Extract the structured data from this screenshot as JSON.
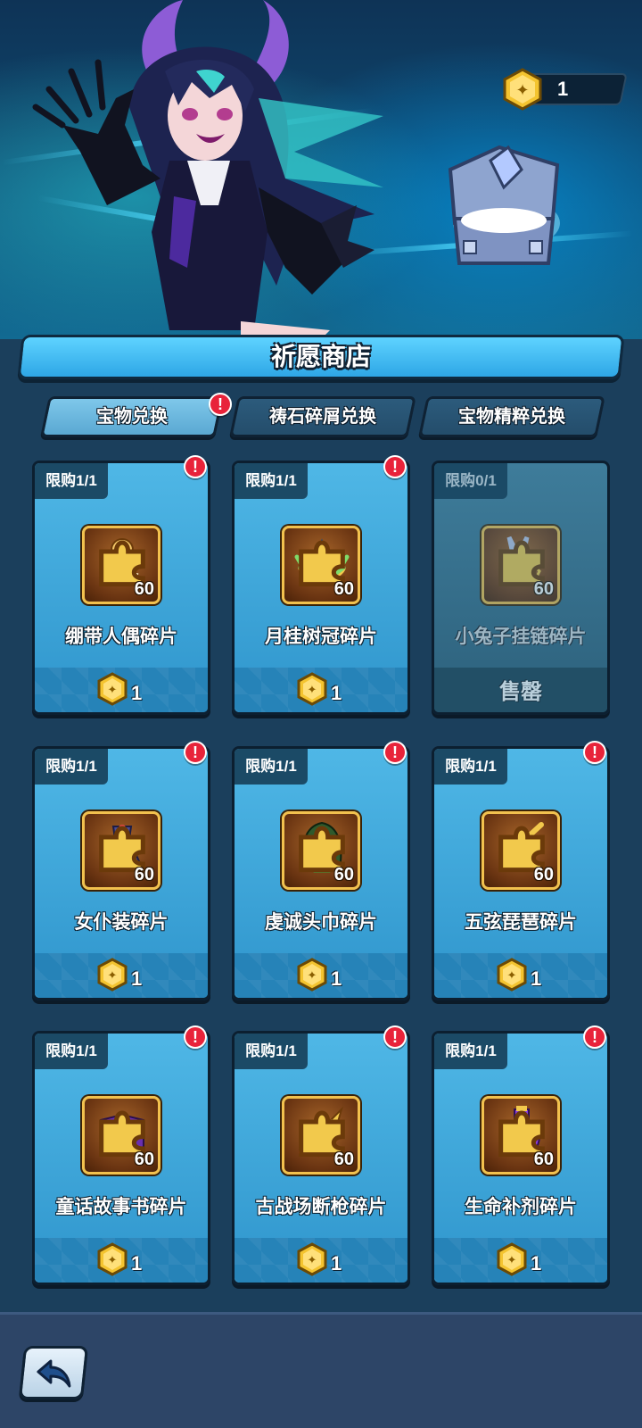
{
  "currency": {
    "icon": "gold-coin-icon",
    "amount": "1"
  },
  "shop": {
    "title": "祈愿商店"
  },
  "tabs": [
    {
      "label": "宝物兑换",
      "active": true,
      "alert": true
    },
    {
      "label": "祷石碎屑兑换",
      "active": false,
      "alert": false
    },
    {
      "label": "宝物精粹兑换",
      "active": false,
      "alert": false
    }
  ],
  "items": [
    {
      "limit": "限购1/1",
      "name": "绷带人偶碎片",
      "qty": "60",
      "price": "1",
      "sold_out": false,
      "alert": true,
      "icon": "bandage-doll-icon"
    },
    {
      "limit": "限购1/1",
      "name": "月桂树冠碎片",
      "qty": "60",
      "price": "1",
      "sold_out": false,
      "alert": true,
      "icon": "laurel-crown-icon"
    },
    {
      "limit": "限购0/1",
      "name": "小兔子挂链碎片",
      "qty": "60",
      "price": "",
      "sold_out": true,
      "sold_out_label": "售罄",
      "alert": false,
      "icon": "bunny-chain-icon"
    },
    {
      "limit": "限购1/1",
      "name": "女仆装碎片",
      "qty": "60",
      "price": "1",
      "sold_out": false,
      "alert": true,
      "icon": "maid-dress-icon"
    },
    {
      "limit": "限购1/1",
      "name": "虔诚头巾碎片",
      "qty": "60",
      "price": "1",
      "sold_out": false,
      "alert": true,
      "icon": "devout-hood-icon"
    },
    {
      "limit": "限购1/1",
      "name": "五弦琵琶碎片",
      "qty": "60",
      "price": "1",
      "sold_out": false,
      "alert": true,
      "icon": "pipa-lute-icon"
    },
    {
      "limit": "限购1/1",
      "name": "童话故事书碎片",
      "qty": "60",
      "price": "1",
      "sold_out": false,
      "alert": true,
      "icon": "fairy-book-icon"
    },
    {
      "limit": "限购1/1",
      "name": "古战场断枪碎片",
      "qty": "60",
      "price": "1",
      "sold_out": false,
      "alert": true,
      "icon": "broken-spear-icon"
    },
    {
      "limit": "限购1/1",
      "name": "生命补剂碎片",
      "qty": "60",
      "price": "1",
      "sold_out": false,
      "alert": true,
      "icon": "life-potion-icon"
    }
  ],
  "alert_mark": "!",
  "colors": {
    "accent": "#2ea6e6",
    "card": "#3fa6d9",
    "alert": "#e8233a",
    "coin": "#f4c430"
  }
}
